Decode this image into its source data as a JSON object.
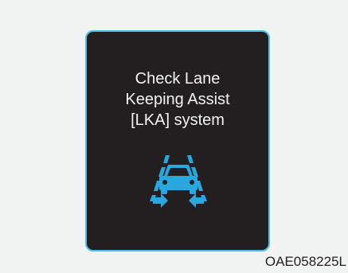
{
  "warning_panel": {
    "message_lines": [
      "Check Lane",
      "Keeping Assist",
      "[LKA] system"
    ],
    "icon": "lane-keeping-assist-icon",
    "accent_color": "#29a8e0",
    "background_color": "#231f20",
    "border_color": "#4fc1e9"
  },
  "figure_code": "OAE058225L"
}
